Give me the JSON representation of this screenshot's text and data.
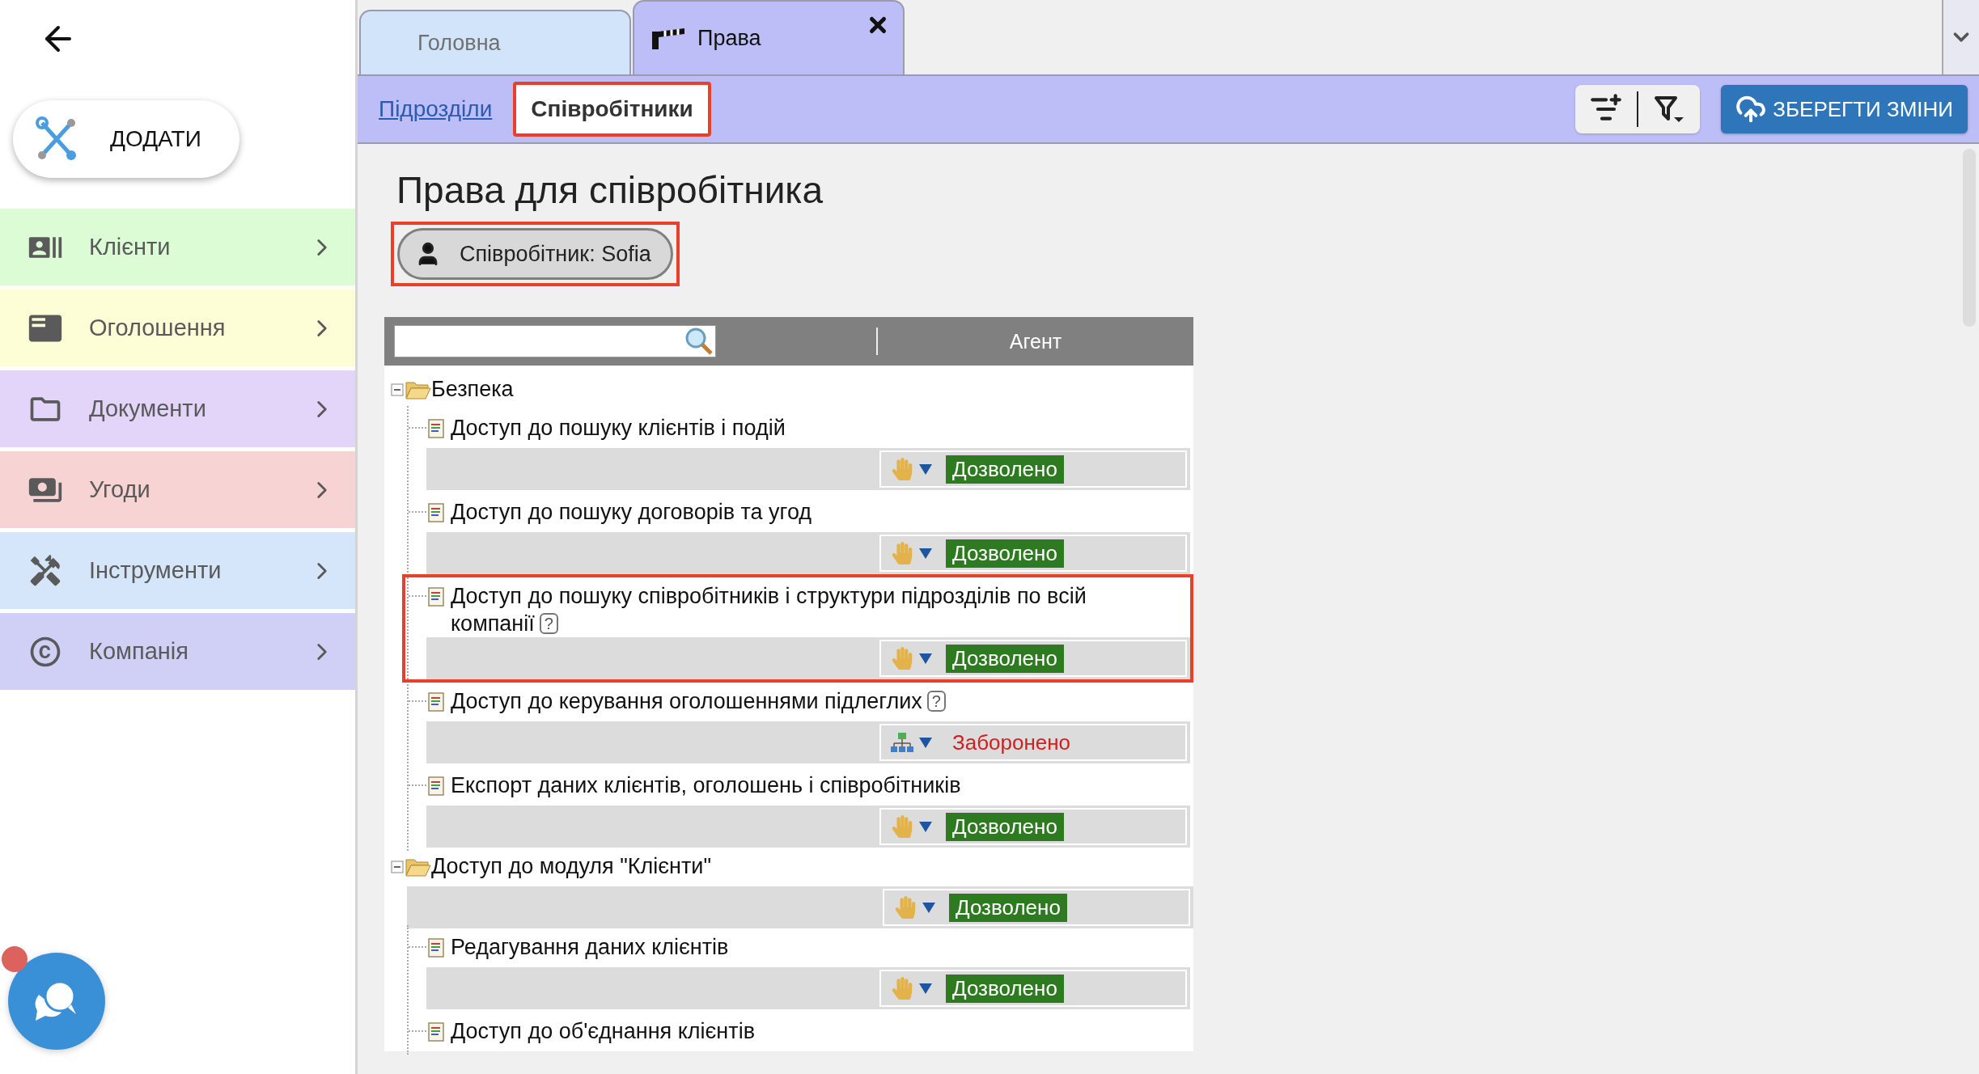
{
  "sidebar": {
    "add_button": "ДОДАТИ",
    "items": [
      {
        "label": "Клієнти",
        "kind": "clients",
        "color": "#dcfcd6"
      },
      {
        "label": "Оголошення",
        "kind": "listings",
        "color": "#fdfdd6"
      },
      {
        "label": "Документи",
        "kind": "documents",
        "color": "#e3d4fa"
      },
      {
        "label": "Угоди",
        "kind": "deals",
        "color": "#f7d3d3"
      },
      {
        "label": "Інструменти",
        "kind": "tools",
        "color": "#d6e6fa"
      },
      {
        "label": "Компанія",
        "kind": "company",
        "color": "#d0d0f6"
      }
    ],
    "chat_badge": true
  },
  "tabs": [
    {
      "label": "Головна",
      "selected": false,
      "closable": false
    },
    {
      "label": "Права",
      "selected": true,
      "closable": true
    }
  ],
  "subtabs": [
    {
      "label": "Підрозділи",
      "selected": false
    },
    {
      "label": "Співробітники",
      "selected": true,
      "highlighted": true
    }
  ],
  "save_button": "ЗБЕРЕГТИ ЗМІНИ",
  "title": "Права для співробітника",
  "employee_chip": {
    "label": "Співробітник: Sofia",
    "highlighted": true
  },
  "table": {
    "column": "Агент",
    "tree": [
      {
        "label": "Безпека",
        "kind": "folder",
        "expanded": true,
        "children": [
          {
            "label": "Доступ до пошуку клієнтів і подій",
            "kind": "leaf",
            "highlighted": false,
            "permission": {
              "kind": "manual",
              "allowed": true,
              "value": "Дозволено"
            }
          },
          {
            "label": "Доступ до пошуку договорів та угод",
            "kind": "leaf",
            "highlighted": false,
            "permission": {
              "kind": "manual",
              "allowed": true,
              "value": "Дозволено"
            }
          },
          {
            "label": "Доступ до пошуку співробітників і структури підрозділів по всій компанії",
            "kind": "leaf",
            "help": "?",
            "highlighted": true,
            "permission": {
              "kind": "manual",
              "allowed": true,
              "value": "Дозволено"
            }
          },
          {
            "label": "Доступ до керування оголошеннями підлеглих",
            "kind": "leaf",
            "help": "?",
            "highlighted": false,
            "permission": {
              "kind": "structure",
              "allowed": false,
              "value": "Заборонено"
            }
          },
          {
            "label": "Експорт даних клієнтів, оголошень і співробітників",
            "kind": "leaf",
            "highlighted": false,
            "permission": {
              "kind": "manual",
              "allowed": true,
              "value": "Дозволено"
            }
          }
        ]
      },
      {
        "label": "Доступ до модуля \"Клієнти\"",
        "kind": "folder",
        "expanded": true,
        "permission": {
          "kind": "manual",
          "allowed": true,
          "value": "Дозволено"
        },
        "children": [
          {
            "label": "Редагування даних клієнтів",
            "kind": "leaf",
            "highlighted": false,
            "permission": {
              "kind": "manual",
              "allowed": true,
              "value": "Дозволено"
            }
          },
          {
            "label": "Доступ до об'єднання клієнтів",
            "kind": "leaf",
            "highlighted": false
          }
        ]
      }
    ]
  }
}
